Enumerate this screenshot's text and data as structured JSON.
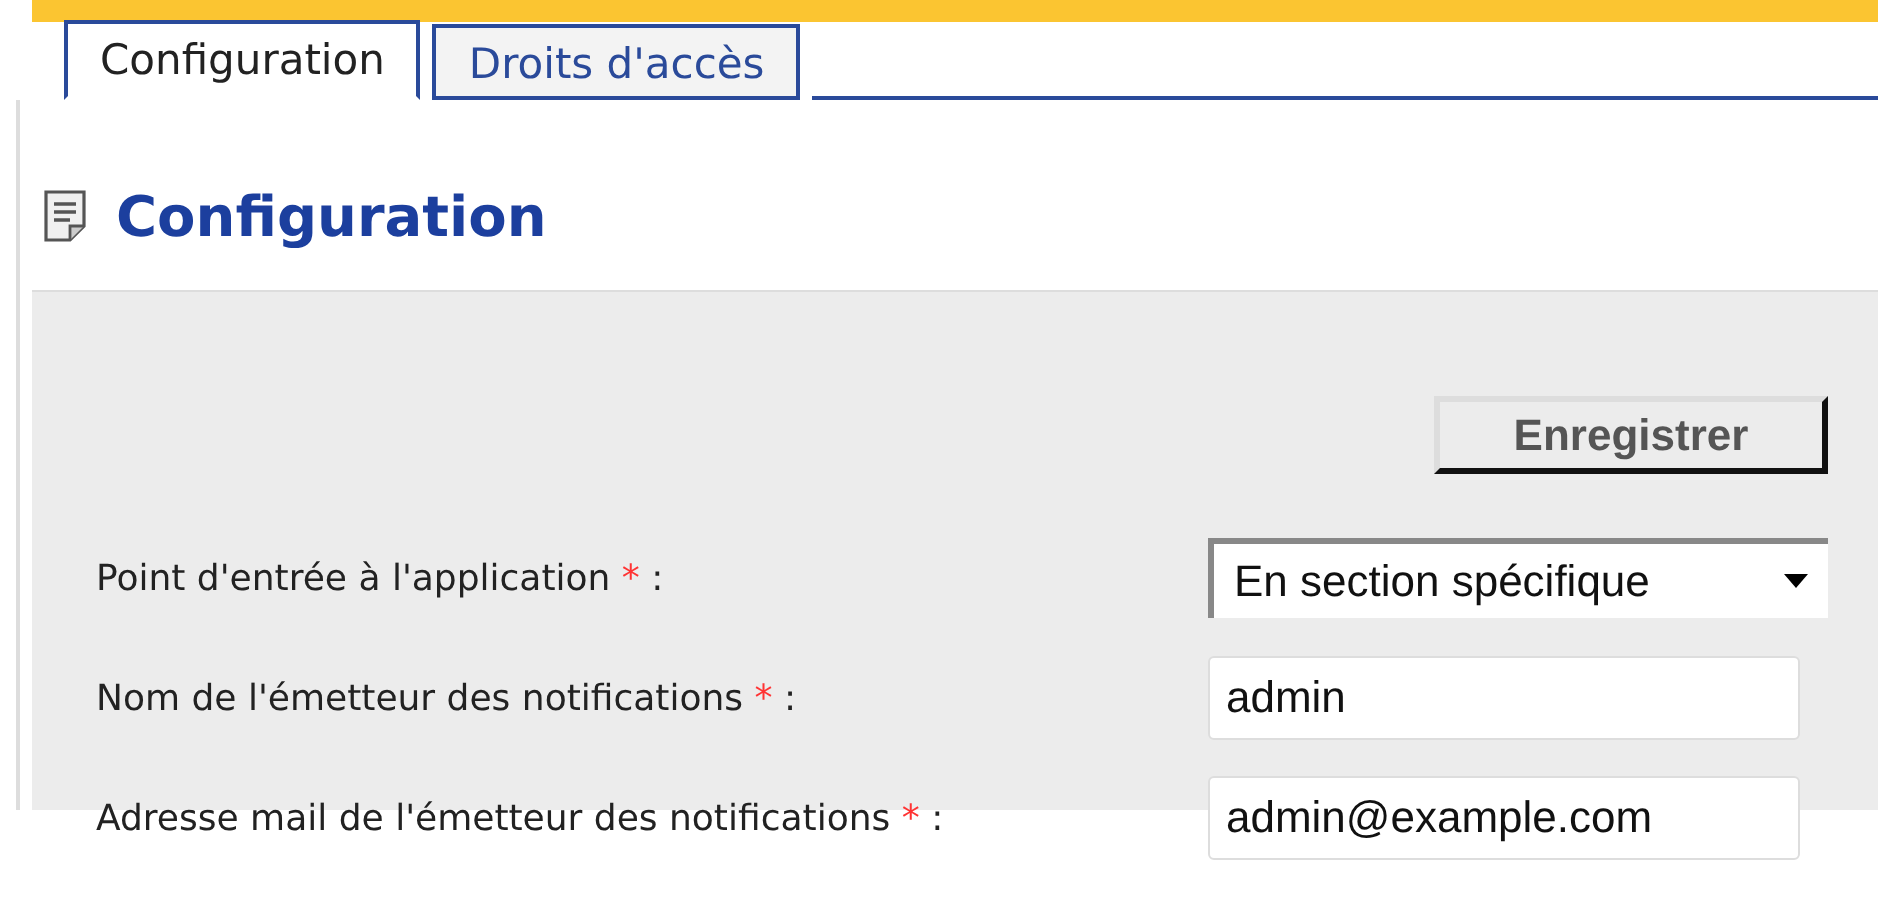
{
  "tabs": [
    {
      "label": "Configuration",
      "selected": true
    },
    {
      "label": "Droits d'accès",
      "selected": false
    }
  ],
  "heading": "Configuration",
  "save_button": "Enregistrer",
  "fields": [
    {
      "kind": "select",
      "label": "Point d'entrée à l'application",
      "required": "*",
      "colon": ":",
      "value": "En section spécifique"
    },
    {
      "kind": "text",
      "label": "Nom de l'émetteur des notifications",
      "required": "*",
      "colon": ":",
      "value": "admin"
    },
    {
      "kind": "text",
      "label": "Adresse mail de l'émetteur des notifications",
      "required": "*",
      "colon": ":",
      "value": "admin@example.com"
    }
  ]
}
